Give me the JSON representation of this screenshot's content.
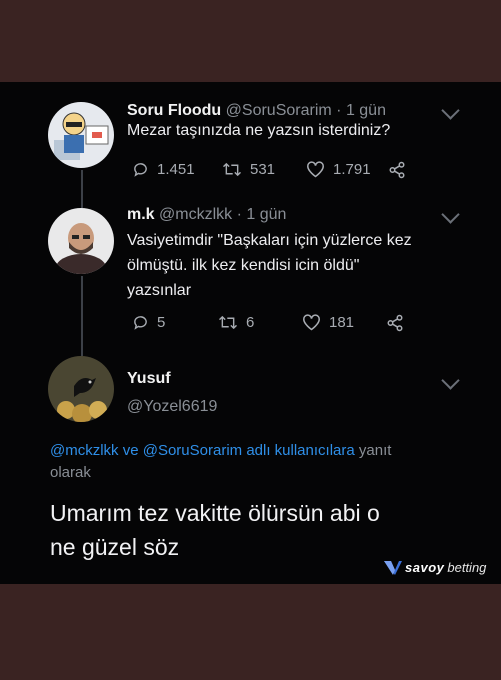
{
  "tweets": [
    {
      "name": "Soru Floodu",
      "handle": "@SoruSorarim",
      "dot": "·",
      "time": "1 gün",
      "text": "Mezar taşınızda ne yazsın isterdiniz?",
      "replies": "1.451",
      "retweets": "531",
      "likes": "1.791"
    },
    {
      "name": "m.k",
      "handle": "@mckzlkk",
      "dot": "·",
      "time": "1 gün",
      "text_lines": [
        "Vasiyetimdir \"Başkaları için yüzlerce kez",
        "ölmüştü. ilk kez kendisi icin öldü\"",
        "yazsınlar"
      ],
      "replies": "5",
      "retweets": "6",
      "likes": "181"
    }
  ],
  "reply_tweet": {
    "name": "Yusuf",
    "handle": "@Yozel6619",
    "reply_link": "@mckzlkk ve @SoruSorarim adlı kullanıcılara",
    "reply_suffix": "yanıt",
    "reply_suffix2": "olarak",
    "text_lines": [
      "Umarım tez vakitte ölürsün abi o",
      "ne güzel söz"
    ]
  },
  "watermark": {
    "text_bold": "savoy",
    "text_thin": "betting"
  },
  "colors": {
    "link": "#2f8fe8",
    "meta": "#8a8f96",
    "background": "#050506",
    "frame": "#3a2322"
  },
  "icons": [
    "reply-icon",
    "retweet-icon",
    "like-icon",
    "share-icon",
    "chevron-down-icon"
  ]
}
